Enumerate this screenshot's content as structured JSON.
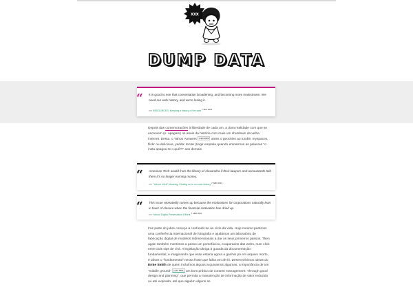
{
  "colors": {
    "accent_pink": "#c2187f",
    "accent_black": "#111111",
    "link_green": "#2a9d6e",
    "band_grey": "#eeeeee"
  },
  "logo": {
    "badge_text": "XXX",
    "icon": "skull-character-mascot"
  },
  "site": {
    "title": "DUMP DATA"
  },
  "quote1": {
    "text": "It is good to see that conversation broadening, and becoming more mainstream. We need our web history, and we're losing it.",
    "source_prefix": "em",
    "source_link": "RESOURCES: Keeping a history of the web",
    "date": "7 MAI 2021"
  },
  "para1": {
    "t1": "Depois das",
    "link": "comemorações",
    "t2": "à liberdade de cada um, a dura realidade com que se escrevem (e. apagam) os anais da história com mais um shutdown da velha internet. Desta, o Yahoo Answers",
    "tag": "4 abr 2021",
    "t3": "antes o geocities ao tumblr. myspaces, flickr ou delicious, yadda: tentar (tingir empatia quando entoarmos as palavras \"o insta apagou-te o quê?!\" aos demais"
  },
  "quote2": {
    "text": "American Tech would from the library of Alexandria if their lawyers and accountants told them it's no longer earning money.",
    "source_prefix": "em",
    "source_link": "\"Yahoo! Web\" Mocking, Kinking us in our own history",
    "date": "7 ABR 2021"
  },
  "quote3": {
    "text": "This issue repeatedly comes up because the motivations for corporations naturally lean in favor of closure when the financial motivation has dried up.",
    "source_prefix": "em",
    "source_link": "Yahoo! Digital Preservation Efforts",
    "date": "7 ABR 2021"
  },
  "para2": {
    "t1": "Faz parte do jobre começa a confundir-se ao ciclo da vida. Hoje mesmo partimos uma conferência internacional de fotografia e ajudámos um laboratório de fabricação digital de modelos tridimensionais a dar os seus primeiros passos. Then again também mentimos a passo um pontofácico, evaporados das webs, num click entre dois sips de chá. A legislação obriga à guarda da documentação fundamental, e imaginando que essa estaria agora a ganhar pó em arquivo morto, é talvez o \"fundamental\" nessa frase que falha em ah-ló. Desenvolvimos ideias do",
    "name": "Ernie Smith",
    "t2": "de quem incluímos alguns arquivamos algumas, a importância de um \"middle ground\"",
    "tag": "7 abr 2021",
    "t3": "um bom prática de content management: \"through good design and planning\", que permita a manutenção de informação de valor reduzido ou até expirado, até que alguém alguns se"
  }
}
